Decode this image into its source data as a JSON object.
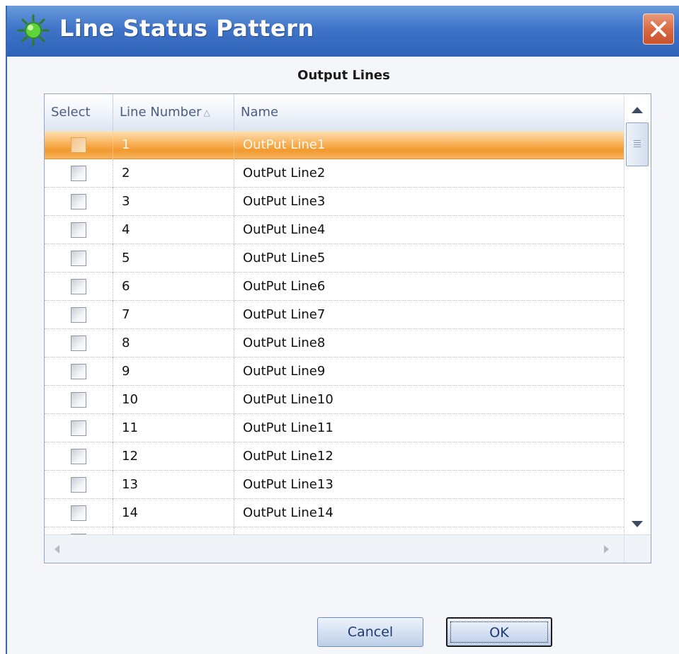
{
  "window": {
    "title": "Line Status Pattern",
    "icon": "green-sun-icon",
    "close_icon": "close-icon"
  },
  "section": {
    "label": "Output Lines"
  },
  "grid": {
    "columns": [
      "Select",
      "Line Number",
      "Name"
    ],
    "sort_column": "Line Number",
    "sort_indicator": "△",
    "selected_row": 0,
    "rows": [
      {
        "line_number": "1",
        "name": "OutPut Line1",
        "checked": false
      },
      {
        "line_number": "2",
        "name": "OutPut Line2",
        "checked": false
      },
      {
        "line_number": "3",
        "name": "OutPut Line3",
        "checked": false
      },
      {
        "line_number": "4",
        "name": "OutPut Line4",
        "checked": false
      },
      {
        "line_number": "5",
        "name": "OutPut Line5",
        "checked": false
      },
      {
        "line_number": "6",
        "name": "OutPut Line6",
        "checked": false
      },
      {
        "line_number": "7",
        "name": "OutPut Line7",
        "checked": false
      },
      {
        "line_number": "8",
        "name": "OutPut Line8",
        "checked": false
      },
      {
        "line_number": "9",
        "name": "OutPut Line9",
        "checked": false
      },
      {
        "line_number": "10",
        "name": "OutPut Line10",
        "checked": false
      },
      {
        "line_number": "11",
        "name": "OutPut Line11",
        "checked": false
      },
      {
        "line_number": "12",
        "name": "OutPut Line12",
        "checked": false
      },
      {
        "line_number": "13",
        "name": "OutPut Line13",
        "checked": false
      },
      {
        "line_number": "14",
        "name": "OutPut Line14",
        "checked": false
      }
    ]
  },
  "buttons": {
    "cancel": "Cancel",
    "ok": "OK"
  },
  "colors": {
    "titlebar": "#3f74c8",
    "selected_row": "#f19a2f",
    "close_button": "#d96a43"
  }
}
